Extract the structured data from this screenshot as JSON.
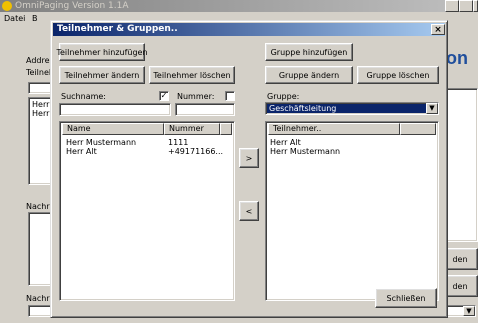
{
  "main_window": {
    "title": "OmniPaging Version 1.1A",
    "menu": [
      "Datei",
      "B"
    ],
    "labels": {
      "address": "Addres",
      "participant": "Teilneh",
      "item_a": "Herr A",
      "item_m": "Herr M",
      "message": "Nachri",
      "message2": "Nachri"
    },
    "right_buttons": [
      "den",
      "den"
    ],
    "logo_fragment": "on"
  },
  "dialog": {
    "title": "Teilnehmer & Gruppen..",
    "buttons": {
      "add_participant": "Teilnehmer hinzufügen",
      "edit_participant": "Teilnehmer ändern",
      "delete_participant": "Teilnehmer löschen",
      "add_group": "Gruppe hinzufügen",
      "edit_group": "Gruppe ändern",
      "delete_group": "Gruppe löschen",
      "move_right": ">",
      "move_left": "<",
      "close": "Schließen"
    },
    "search_label": "Suchname:",
    "number_label": "Nummer:",
    "group_label": "Gruppe:",
    "group_selected": "Geschäftsleitung",
    "search_checked": true,
    "number_checked": false,
    "participants_table": {
      "columns": [
        "Name",
        "Nummer"
      ],
      "rows": [
        {
          "name": "Herr Mustermann",
          "number": "1111"
        },
        {
          "name": "Herr Alt",
          "number": "+49171166..."
        }
      ]
    },
    "group_members": {
      "column": "Teilnehmer..",
      "rows": [
        "Herr Alt",
        "Herr Mustermann"
      ]
    }
  }
}
